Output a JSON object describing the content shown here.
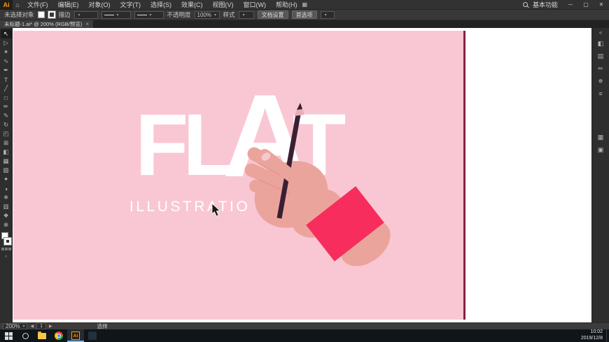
{
  "menubar": {
    "logo": "Ai",
    "items": [
      "文件(F)",
      "编辑(E)",
      "对象(O)",
      "文字(T)",
      "选择(S)",
      "效果(C)",
      "视图(V)",
      "窗口(W)",
      "帮助(H)"
    ],
    "arrange_icon": "▦",
    "workspace": "基本功能",
    "window_controls": {
      "minimize": "─",
      "maximize": "▢",
      "close": "✕"
    }
  },
  "controlbar": {
    "selection_status": "未选择对象",
    "stroke_label": "描边",
    "opacity_label": "不透明度",
    "opacity_value": "100%",
    "style_label": "样式",
    "doc_setup_button": "文档设置",
    "preferences_button": "首选项"
  },
  "document_tab": {
    "title": "未标题-1.ai* @ 200% (RGB/预览)",
    "close": "×"
  },
  "toolbar": {
    "tools": [
      {
        "name": "selection-tool",
        "glyph": "↖"
      },
      {
        "name": "direct-selection-tool",
        "glyph": "▷"
      },
      {
        "name": "magic-wand-tool",
        "glyph": "✶"
      },
      {
        "name": "lasso-tool",
        "glyph": "∿"
      },
      {
        "name": "pen-tool",
        "glyph": "✒"
      },
      {
        "name": "type-tool",
        "glyph": "T"
      },
      {
        "name": "line-tool",
        "glyph": "╱"
      },
      {
        "name": "rectangle-tool",
        "glyph": "□"
      },
      {
        "name": "paintbrush-tool",
        "glyph": "✏"
      },
      {
        "name": "pencil-tool",
        "glyph": "✎"
      },
      {
        "name": "rotate-tool",
        "glyph": "↻"
      },
      {
        "name": "scale-tool",
        "glyph": "◰"
      },
      {
        "name": "free-transform-tool",
        "glyph": "⊞"
      },
      {
        "name": "shape-builder-tool",
        "glyph": "◧"
      },
      {
        "name": "mesh-tool",
        "glyph": "▦"
      },
      {
        "name": "gradient-tool",
        "glyph": "▧"
      },
      {
        "name": "eyedropper-tool",
        "glyph": "✦"
      },
      {
        "name": "blend-tool",
        "glyph": "◑"
      },
      {
        "name": "symbol-sprayer-tool",
        "glyph": "✵"
      },
      {
        "name": "graph-tool",
        "glyph": "▥"
      },
      {
        "name": "hand-tool",
        "glyph": "❖"
      },
      {
        "name": "zoom-tool",
        "glyph": "⊕"
      }
    ]
  },
  "canvas": {
    "artwork": {
      "letters": [
        "F",
        "L",
        "A",
        "T"
      ],
      "subtitle": "ILLUSTRATIO N",
      "colors": {
        "background": "#f9c7d3",
        "edge": "#842243",
        "skin": "#eba49c",
        "skin_shadow": "#e2978f",
        "cuff": "#f72d5e",
        "pencil": "#3a1f33",
        "pencil_wood": "#e8aeb6",
        "nail": "#f6c9cd",
        "text": "#ffffff"
      }
    }
  },
  "right_dock": {
    "expand": "«",
    "panels": [
      {
        "name": "color-panel",
        "glyph": "◧"
      },
      {
        "name": "swatches-panel",
        "glyph": "▤"
      },
      {
        "name": "brushes-panel",
        "glyph": "✏"
      },
      {
        "name": "symbols-panel",
        "glyph": "✵"
      },
      {
        "name": "stroke-panel",
        "glyph": "≡"
      },
      {
        "name": "layers-panel",
        "glyph": "▦"
      },
      {
        "name": "artboards-panel",
        "glyph": "▣"
      }
    ]
  },
  "statusbar": {
    "zoom": "200%",
    "artboard_number": "1",
    "tool_hint": "选择"
  },
  "taskbar": {
    "time": "10:02",
    "date": "2019/12/8"
  }
}
